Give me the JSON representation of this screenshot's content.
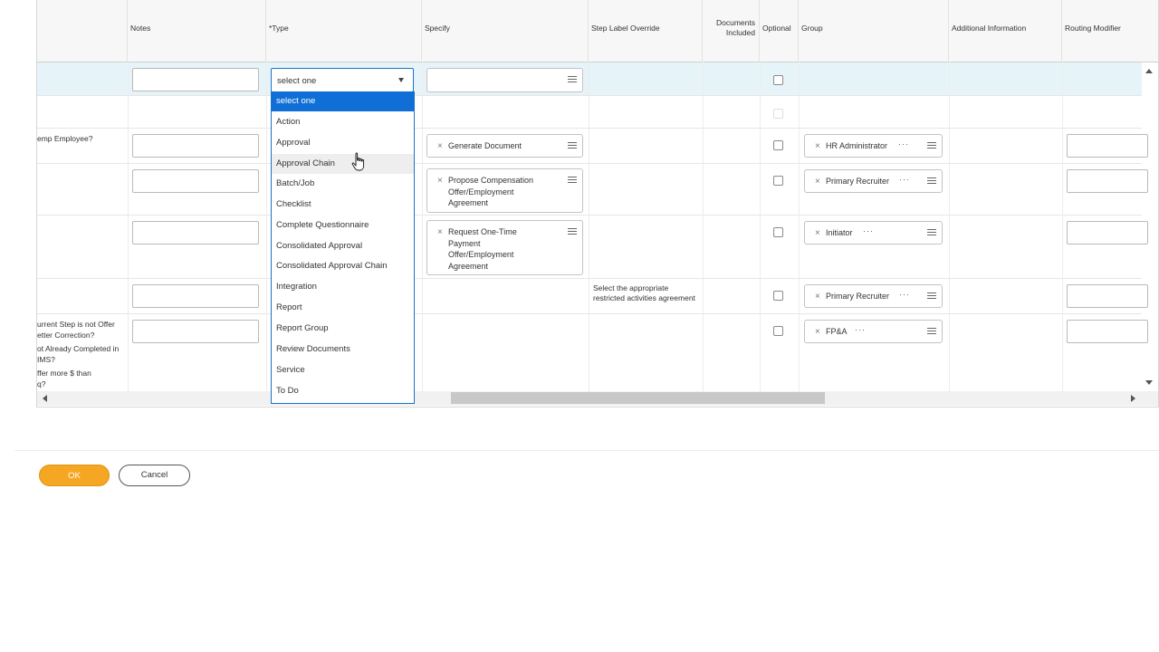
{
  "columns": {
    "notes": "Notes",
    "type": "*Type",
    "specify": "Specify",
    "step_label_override": "Step Label Override",
    "documents_included": "Documents Included",
    "optional": "Optional",
    "group": "Group",
    "additional_information": "Additional Information",
    "routing_modifier": "Routing Modifier"
  },
  "row_labels": {
    "r3": "emp Employee?",
    "r7a": "urrent Step is not Offer",
    "r7b": "etter Correction?",
    "r7c": "ot Already Completed in",
    "r7d": "IMS?",
    "r7e": "ffer more $ than",
    "r7f": "q?"
  },
  "type_select": {
    "value": "select one",
    "options": [
      "select one",
      "Action",
      "Approval",
      "Approval Chain",
      "Batch/Job",
      "Checklist",
      "Complete Questionnaire",
      "Consolidated Approval",
      "Consolidated Approval Chain",
      "Integration",
      "Report",
      "Report Group",
      "Review Documents",
      "Service",
      "To Do"
    ],
    "highlighted": "select one",
    "hovered": "Approval Chain"
  },
  "specify": {
    "r3": "Generate Document",
    "r4a": "Propose Compensation",
    "r4b": "Offer/Employment",
    "r4c": "Agreement",
    "r5a": "Request One-Time",
    "r5b": "Payment",
    "r5c": "Offer/Employment",
    "r5d": "Agreement"
  },
  "step_label": {
    "r6a": "Select the appropriate",
    "r6b": "restricted activities agreement"
  },
  "groups": {
    "r3": "HR Administrator",
    "r4": "Primary Recruiter",
    "r5": "Initiator",
    "r6": "Primary Recruiter",
    "r7": "FP&A"
  },
  "buttons": {
    "ok": "OK",
    "cancel": "Cancel"
  },
  "colors": {
    "selected_row": "#e6f4f9",
    "accent_blue": "#0f6fd6",
    "ok_orange": "#f5a623"
  }
}
